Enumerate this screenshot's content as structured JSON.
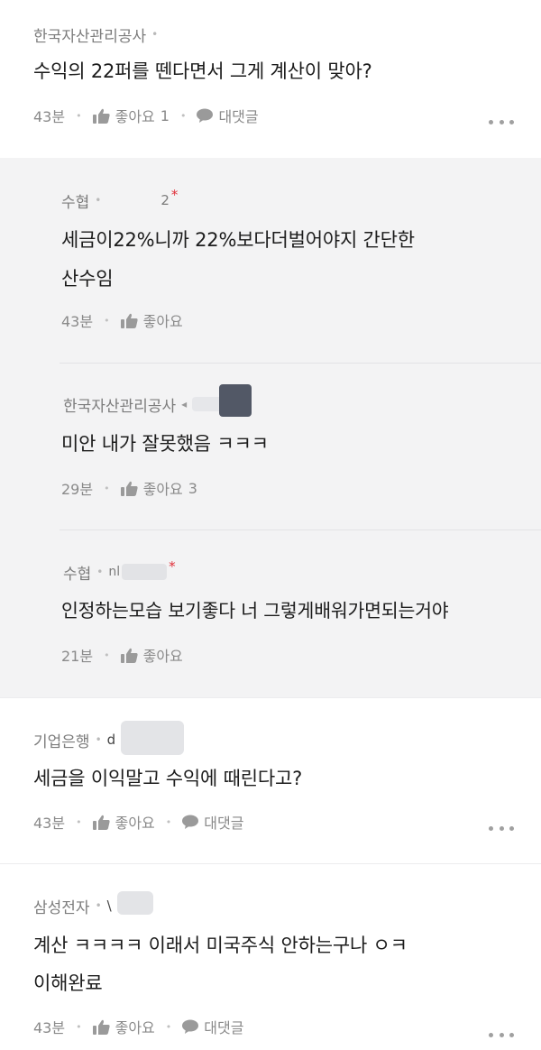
{
  "comments": [
    {
      "author": "한국자산관리공사",
      "text": "수익의 22퍼를 뗀다면서 그게 계산이 맞아?",
      "time": "43분",
      "like_label": "좋아요",
      "like_count": "1",
      "reply_label": "대댓글"
    },
    {
      "author": "기업은행",
      "nick": "d",
      "text": "세금을 이익말고 수익에 때린다고?",
      "time": "43분",
      "like_label": "좋아요",
      "reply_label": "대댓글"
    },
    {
      "author": "삼성전자",
      "nick": "\\",
      "text_line1": "계산 ㅋㅋㅋㅋ 이래서 미국주식 안하는구나 ㅇㅋ",
      "text_line2": "이해완료",
      "time": "43분",
      "like_label": "좋아요",
      "reply_label": "대댓글"
    }
  ],
  "replies": [
    {
      "author": "수협",
      "nick": "2",
      "text_line1": "세금이22%니까 22%보다더벌어야지 간단한",
      "text_line2": "산수임",
      "time": "43분",
      "like_label": "좋아요"
    },
    {
      "author": "한국자산관리공사",
      "nick": "◂",
      "text": "미안 내가 잘못했음 ㅋㅋㅋ",
      "time": "29분",
      "like_label": "좋아요",
      "like_count": "3"
    },
    {
      "author": "수협",
      "nick": "nl",
      "text": "인정하는모습 보기좋다 너 그렇게배워가면되는거야",
      "time": "21분",
      "like_label": "좋아요"
    }
  ],
  "icons": {
    "thumb": "thumbs-up-icon",
    "chat": "speech-bubble-icon",
    "more": "more-dots-icon"
  },
  "colors": {
    "background": "#ffffff",
    "reply_background": "#f3f3f4",
    "text": "#1c1c1c",
    "meta": "#8a8a8a",
    "star": "#e0303a"
  }
}
